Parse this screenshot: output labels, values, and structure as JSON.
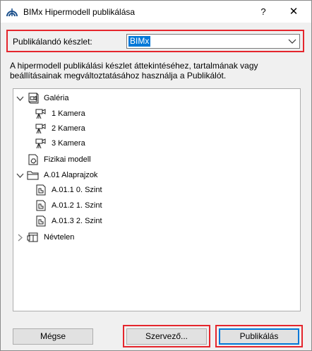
{
  "window": {
    "title": "BIMx Hipermodell publikálása",
    "help_label": "?",
    "close_label": "✕"
  },
  "publish_set": {
    "label": "Publikálandó készlet:",
    "selected": "BIMx"
  },
  "description": "A hipermodell publikálási készlet áttekintéséhez, tartalmának vagy beállításainak megváltoztatásához használja a Publikálót.",
  "tree": {
    "items": [
      {
        "label": "Galéria",
        "icon": "gallery-icon",
        "toggle": "expanded"
      },
      {
        "label": "1 Kamera",
        "icon": "camera-icon"
      },
      {
        "label": "2 Kamera",
        "icon": "camera-icon"
      },
      {
        "label": "3 Kamera",
        "icon": "camera-icon"
      },
      {
        "label": "Fizikai modell",
        "icon": "model-icon"
      },
      {
        "label": "A.01 Alaprajzok",
        "icon": "folder-icon",
        "toggle": "expanded"
      },
      {
        "label": "A.01.1 0. Szint",
        "icon": "view-icon"
      },
      {
        "label": "A.01.2 1. Szint",
        "icon": "view-icon"
      },
      {
        "label": "A.01.3 2. Szint",
        "icon": "view-icon"
      },
      {
        "label": "Névtelen",
        "icon": "layout-icon",
        "toggle": "collapsed"
      }
    ]
  },
  "buttons": {
    "cancel": "Mégse",
    "organizer": "Szervező...",
    "publish": "Publikálás"
  },
  "colors": {
    "highlight": "#e5262d",
    "selection": "#0078d7"
  }
}
